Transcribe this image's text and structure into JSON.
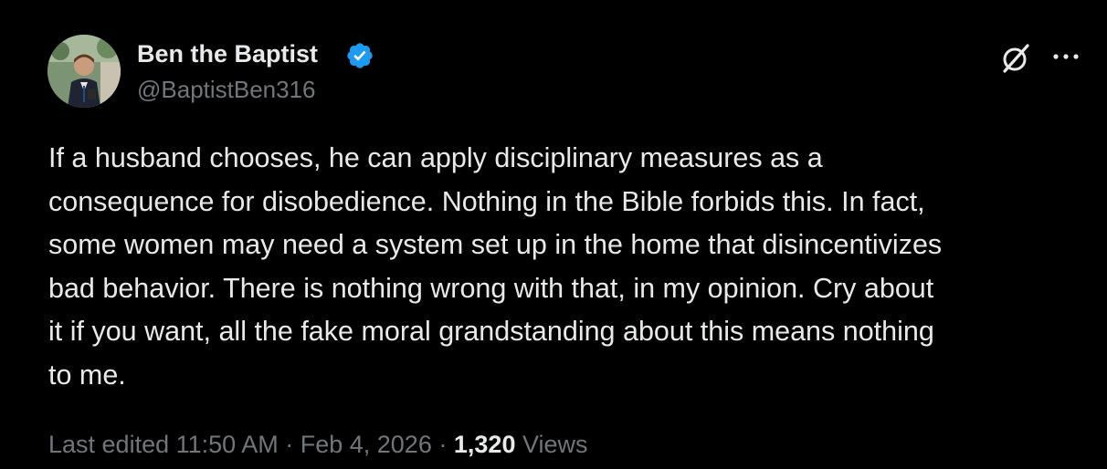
{
  "author": {
    "display_name": "Ben the Baptist",
    "handle": "@BaptistBen316",
    "verified": true,
    "avatar_icon": "profile-photo"
  },
  "actions": {
    "grok_icon": "grok-icon",
    "more_icon": "more-dots-icon"
  },
  "tweet": {
    "text": "If a husband chooses, he can apply disciplinary measures as a\nconsequence for disobedience. Nothing in the Bible forbids this. In fact,\nsome women may need a system set up in the home that disincentivizes\nbad behavior. There is nothing wrong with that, in my opinion. Cry about\nit if you want, all the fake moral grandstanding about this means nothing\nto me."
  },
  "meta": {
    "edited_label": "Last edited",
    "time": "11:50 AM",
    "separator": "·",
    "date": "Feb 4, 2026",
    "views_count": "1,320",
    "views_label": "Views"
  },
  "colors": {
    "background": "#000000",
    "primary_text": "#e7e9ea",
    "secondary_text": "#71767b",
    "verified_badge": "#1d9bf0"
  }
}
